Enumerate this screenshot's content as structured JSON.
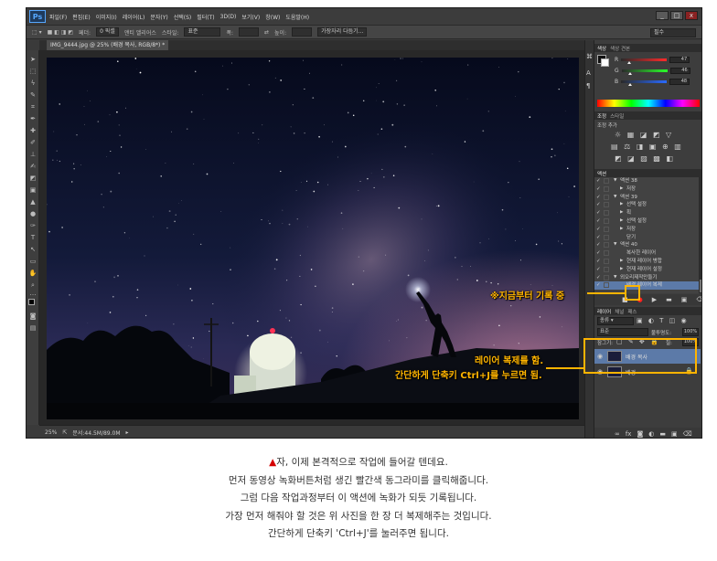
{
  "app": {
    "logo": "Ps",
    "menu": [
      "파일(F)",
      "편집(E)",
      "이미지(I)",
      "레이어(L)",
      "문자(Y)",
      "선택(S)",
      "필터(T)",
      "3D(D)",
      "보기(V)",
      "창(W)",
      "도움말(H)"
    ],
    "window_buttons": [
      "_",
      "□",
      "x"
    ]
  },
  "options_bar": {
    "feather_label": "페더:",
    "feather_value": "0 픽셀",
    "antialias_label": "앤티 앨리어스",
    "style_label": "스타일:",
    "style_value": "표준",
    "width_label": "폭:",
    "height_label": "높이:",
    "refine_button": "가장자리 다듬기...",
    "workspace": "필수"
  },
  "document": {
    "tab_title": "IMG_9444.jpg @ 25% (배경 복사, RGB/8*) *"
  },
  "status_bar": {
    "zoom": "25%",
    "doc_size": "문서:44.5M/89.0M"
  },
  "color_panel": {
    "tabs": [
      "색상",
      "색상 견본"
    ],
    "channels": [
      {
        "name": "R",
        "value": "47",
        "level": 0.18,
        "color": "#ff2a2a"
      },
      {
        "name": "G",
        "value": "46",
        "level": 0.18,
        "color": "#2aff2a"
      },
      {
        "name": "B",
        "value": "48",
        "level": 0.19,
        "color": "#2a6aff"
      }
    ]
  },
  "adjustments_panel": {
    "tabs": [
      "조정",
      "스타일"
    ],
    "title": "조정 추가"
  },
  "actions_panel": {
    "tabs": [
      "액션"
    ],
    "rows": [
      {
        "indent": 1,
        "caret": "▼",
        "label": "액션 38"
      },
      {
        "indent": 2,
        "caret": "▶",
        "label": "저장"
      },
      {
        "indent": 1,
        "caret": "▼",
        "label": "액션 39"
      },
      {
        "indent": 2,
        "caret": "▶",
        "label": "선택 설정"
      },
      {
        "indent": 2,
        "caret": "▶",
        "label": "획"
      },
      {
        "indent": 2,
        "caret": "▶",
        "label": "선택 설정"
      },
      {
        "indent": 2,
        "caret": "▶",
        "label": "저장"
      },
      {
        "indent": 2,
        "caret": "",
        "label": "닫기"
      },
      {
        "indent": 1,
        "caret": "▼",
        "label": "액션 40"
      },
      {
        "indent": 2,
        "caret": "",
        "label": "복사한 레이어"
      },
      {
        "indent": 2,
        "caret": "▶",
        "label": "현재 레이어 병합"
      },
      {
        "indent": 2,
        "caret": "▶",
        "label": "현재 레이어 설정"
      },
      {
        "indent": 1,
        "caret": "▼",
        "label": "외오리제작만들기"
      },
      {
        "indent": 2,
        "caret": "",
        "label": "배경 레이어 복제"
      }
    ]
  },
  "layers_panel": {
    "tabs": [
      "레이어",
      "채널",
      "패스"
    ],
    "kind_filter": "종류",
    "blend_mode": "표준",
    "opacity_label": "불투명도:",
    "opacity_value": "100%",
    "lock_label": "잠그기:",
    "fill_label": "칠:",
    "fill_value": "100%",
    "layers": [
      {
        "name": "배경 복사",
        "selected": true
      },
      {
        "name": "배경",
        "selected": false
      }
    ]
  },
  "annotations": {
    "record_note": "※지금부터 기록 중",
    "duplicate_note_line1": "레이어 복제를 함.",
    "duplicate_note_line2": "간단하게 단축키 Ctrl+J를 누르면 됨.",
    "accent": "#ffb400"
  },
  "caption": {
    "marker": "▲",
    "lines": [
      "자, 이제 본격적으로 작업에 들어갈 텐데요.",
      "먼저 동영상 녹화버튼처럼 생긴 빨간색 동그라미를 클릭해줍니다.",
      "그럼 다음 작업과정부터 이 액션에 녹화가 되듯 기록됩니다.",
      "가장 먼저 해줘야 할 것은 위 사진을 한 장 더 복제해주는 것입니다.",
      "간단하게 단축키 'Ctrl+J'를 눌러주면 됩니다."
    ]
  }
}
